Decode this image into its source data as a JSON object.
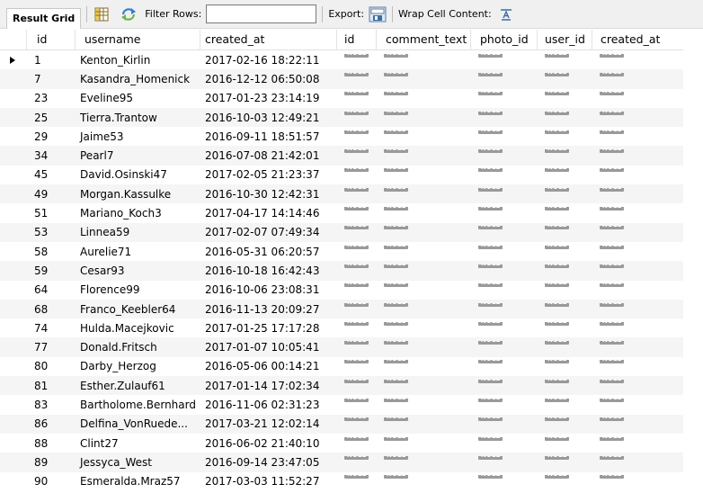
{
  "toolbar": {
    "result_grid_label": "Result Grid",
    "filter_rows_label": "Filter Rows:",
    "filter_value": "",
    "export_label": "Export:",
    "wrap_cell_content_label": "Wrap Cell Content:"
  },
  "columns": [
    "id",
    "username",
    "created_at",
    "id",
    "comment_text",
    "photo_id",
    "user_id",
    "created_at"
  ],
  "null_label": "NULL",
  "rows": [
    {
      "id": "1",
      "username": "Kenton_Kirlin",
      "created_at": "2017-02-16 18:22:11"
    },
    {
      "id": "7",
      "username": "Kasandra_Homenick",
      "created_at": "2016-12-12 06:50:08"
    },
    {
      "id": "23",
      "username": "Eveline95",
      "created_at": "2017-01-23 23:14:19"
    },
    {
      "id": "25",
      "username": "Tierra.Trantow",
      "created_at": "2016-10-03 12:49:21"
    },
    {
      "id": "29",
      "username": "Jaime53",
      "created_at": "2016-09-11 18:51:57"
    },
    {
      "id": "34",
      "username": "Pearl7",
      "created_at": "2016-07-08 21:42:01"
    },
    {
      "id": "45",
      "username": "David.Osinski47",
      "created_at": "2017-02-05 21:23:37"
    },
    {
      "id": "49",
      "username": "Morgan.Kassulke",
      "created_at": "2016-10-30 12:42:31"
    },
    {
      "id": "51",
      "username": "Mariano_Koch3",
      "created_at": "2017-04-17 14:14:46"
    },
    {
      "id": "53",
      "username": "Linnea59",
      "created_at": "2017-02-07 07:49:34"
    },
    {
      "id": "58",
      "username": "Aurelie71",
      "created_at": "2016-05-31 06:20:57"
    },
    {
      "id": "59",
      "username": "Cesar93",
      "created_at": "2016-10-18 16:42:43"
    },
    {
      "id": "64",
      "username": "Florence99",
      "created_at": "2016-10-06 23:08:31"
    },
    {
      "id": "68",
      "username": "Franco_Keebler64",
      "created_at": "2016-11-13 20:09:27"
    },
    {
      "id": "74",
      "username": "Hulda.Macejkovic",
      "created_at": "2017-01-25 17:17:28"
    },
    {
      "id": "77",
      "username": "Donald.Fritsch",
      "created_at": "2017-01-07 10:05:41"
    },
    {
      "id": "80",
      "username": "Darby_Herzog",
      "created_at": "2016-05-06 00:14:21"
    },
    {
      "id": "81",
      "username": "Esther.Zulauf61",
      "created_at": "2017-01-14 17:02:34"
    },
    {
      "id": "83",
      "username": "Bartholome.Bernhard",
      "created_at": "2016-11-06 02:31:23"
    },
    {
      "id": "86",
      "username": "Delfina_VonRuede...",
      "created_at": "2017-03-21 12:02:14"
    },
    {
      "id": "88",
      "username": "Clint27",
      "created_at": "2016-06-02 21:40:10"
    },
    {
      "id": "89",
      "username": "Jessyca_West",
      "created_at": "2016-09-14 23:47:05"
    },
    {
      "id": "90",
      "username": "Esmeralda.Mraz57",
      "created_at": "2017-03-03 11:52:27"
    }
  ],
  "icons": {
    "grid_view": "grid-icon",
    "refresh": "refresh-icon",
    "export": "export-icon",
    "wrap": "wrap-icon",
    "row_marker": "current-row-arrow-icon"
  }
}
